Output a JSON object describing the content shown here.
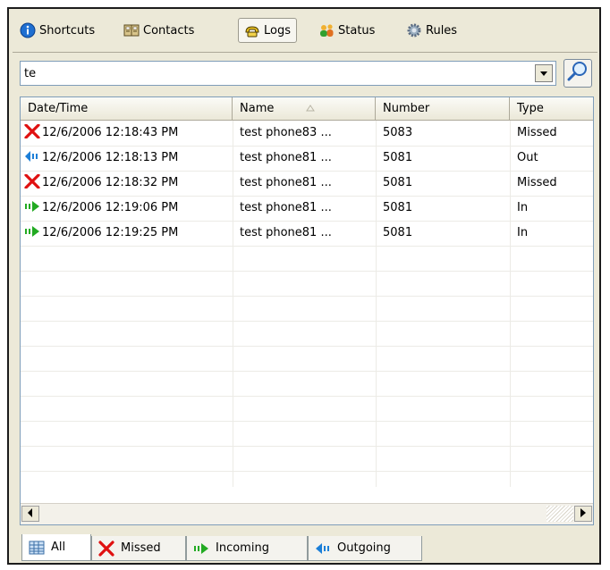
{
  "toolbar": {
    "items": [
      {
        "label": "Shortcuts",
        "icon": "info-icon"
      },
      {
        "label": "Contacts",
        "icon": "contacts-book-icon"
      },
      {
        "label": "Logs",
        "icon": "phone-logs-icon",
        "active": true
      },
      {
        "label": "Status",
        "icon": "status-users-icon"
      },
      {
        "label": "Rules",
        "icon": "rules-gear-icon"
      }
    ]
  },
  "search": {
    "value": "te"
  },
  "grid": {
    "columns": [
      "Date/Time",
      "Name",
      "Number",
      "Type"
    ],
    "sort_column": "Name",
    "rows": [
      {
        "icon": "missed-call-icon",
        "datetime": "12/6/2006 12:18:43 PM",
        "name": "test phone83  ...",
        "number": "5083",
        "type": "Missed"
      },
      {
        "icon": "outgoing-call-icon",
        "datetime": "12/6/2006 12:18:13 PM",
        "name": "test phone81  ...",
        "number": "5081",
        "type": "Out"
      },
      {
        "icon": "missed-call-icon",
        "datetime": "12/6/2006 12:18:32 PM",
        "name": "test phone81  ...",
        "number": "5081",
        "type": "Missed"
      },
      {
        "icon": "incoming-call-icon",
        "datetime": "12/6/2006 12:19:06 PM",
        "name": "test phone81  ...",
        "number": "5081",
        "type": "In"
      },
      {
        "icon": "incoming-call-icon",
        "datetime": "12/6/2006 12:19:25 PM",
        "name": "test phone81  ...",
        "number": "5081",
        "type": "In"
      }
    ]
  },
  "tabs": [
    {
      "label": "All",
      "icon": "table-icon",
      "active": true
    },
    {
      "label": "Missed",
      "icon": "missed-call-icon"
    },
    {
      "label": "Incoming",
      "icon": "incoming-call-icon"
    },
    {
      "label": "Outgoing",
      "icon": "outgoing-call-icon"
    }
  ],
  "colors": {
    "missed": "#e01010",
    "incoming": "#22aa22",
    "outgoing": "#1c7fd8",
    "accent": "#ece9d8"
  }
}
